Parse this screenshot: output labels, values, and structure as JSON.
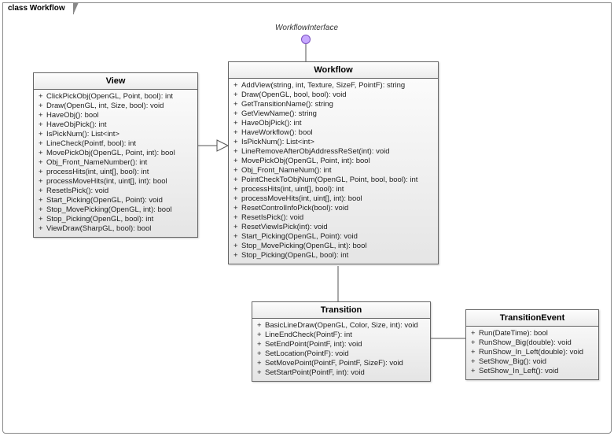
{
  "frame": {
    "label": "class Workflow"
  },
  "interface": {
    "label": "WorkflowInterface"
  },
  "classes": {
    "view": {
      "name": "View",
      "ops": [
        "ClickPickObj(OpenGL, Point, bool): int",
        "Draw(OpenGL, int, Size, bool): void",
        "HaveObj(): bool",
        "HaveObjPick(): int",
        "IsPickNum(): List<int>",
        "LineCheck(Pointf, bool): int",
        "MovePickObj(OpenGL, Point, int): bool",
        "Obj_Front_NameNumber(): int",
        "processHits(int, uint[], bool): int",
        "processMoveHits(int, uint[], int): bool",
        "ResetIsPick(): void",
        "Start_Picking(OpenGL, Point): void",
        "Stop_MovePicking(OpenGL, int): bool",
        "Stop_Picking(OpenGL, bool): int",
        "ViewDraw(SharpGL, bool): bool"
      ]
    },
    "workflow": {
      "name": "Workflow",
      "ops": [
        "AddView(string, int, Texture, SizeF, PointF): string",
        "Draw(OpenGL, bool, bool): void",
        "GetTransitionName(): string",
        "GetViewName(): string",
        "HaveObjPick(): int",
        "HaveWorkflow(): bool",
        "IsPickNum(): List<int>",
        "LineRemoveAfterObjAddressReSet(int): void",
        "MovePickObj(OpenGL, Point, int): bool",
        "Obj_Front_NameNum(): int",
        "PointCheckToObjNum(OpenGL, Point, bool, bool): int",
        "processHits(int, uint[], bool): int",
        "processMoveHits(int, uint[], int): bool",
        "ResetControlInfoPick(bool): void",
        "ResetIsPick(): void",
        "ResetViewIsPick(int): void",
        "Start_Picking(OpenGL, Point): void",
        "Stop_MovePicking(OpenGL, int): bool",
        "Stop_Picking(OpenGL, bool): int"
      ]
    },
    "transition": {
      "name": "Transition",
      "ops": [
        "BasicLineDraw(OpenGL, Color, Size, int): void",
        "LineEndCheck(PointF): int",
        "SetEndPoint(PointF, int): void",
        "SetLocation(PointF): void",
        "SetMovePoint(PointF, PointF, SizeF): void",
        "SetStartPoint(PointF, int): void"
      ]
    },
    "transitionEvent": {
      "name": "TransitionEvent",
      "ops": [
        "Run(DateTime): bool",
        "RunShow_Big(double): void",
        "RunShow_In_Left(double): void",
        "SetShow_Big(): void",
        "SetShow_In_Left(): void"
      ]
    }
  }
}
